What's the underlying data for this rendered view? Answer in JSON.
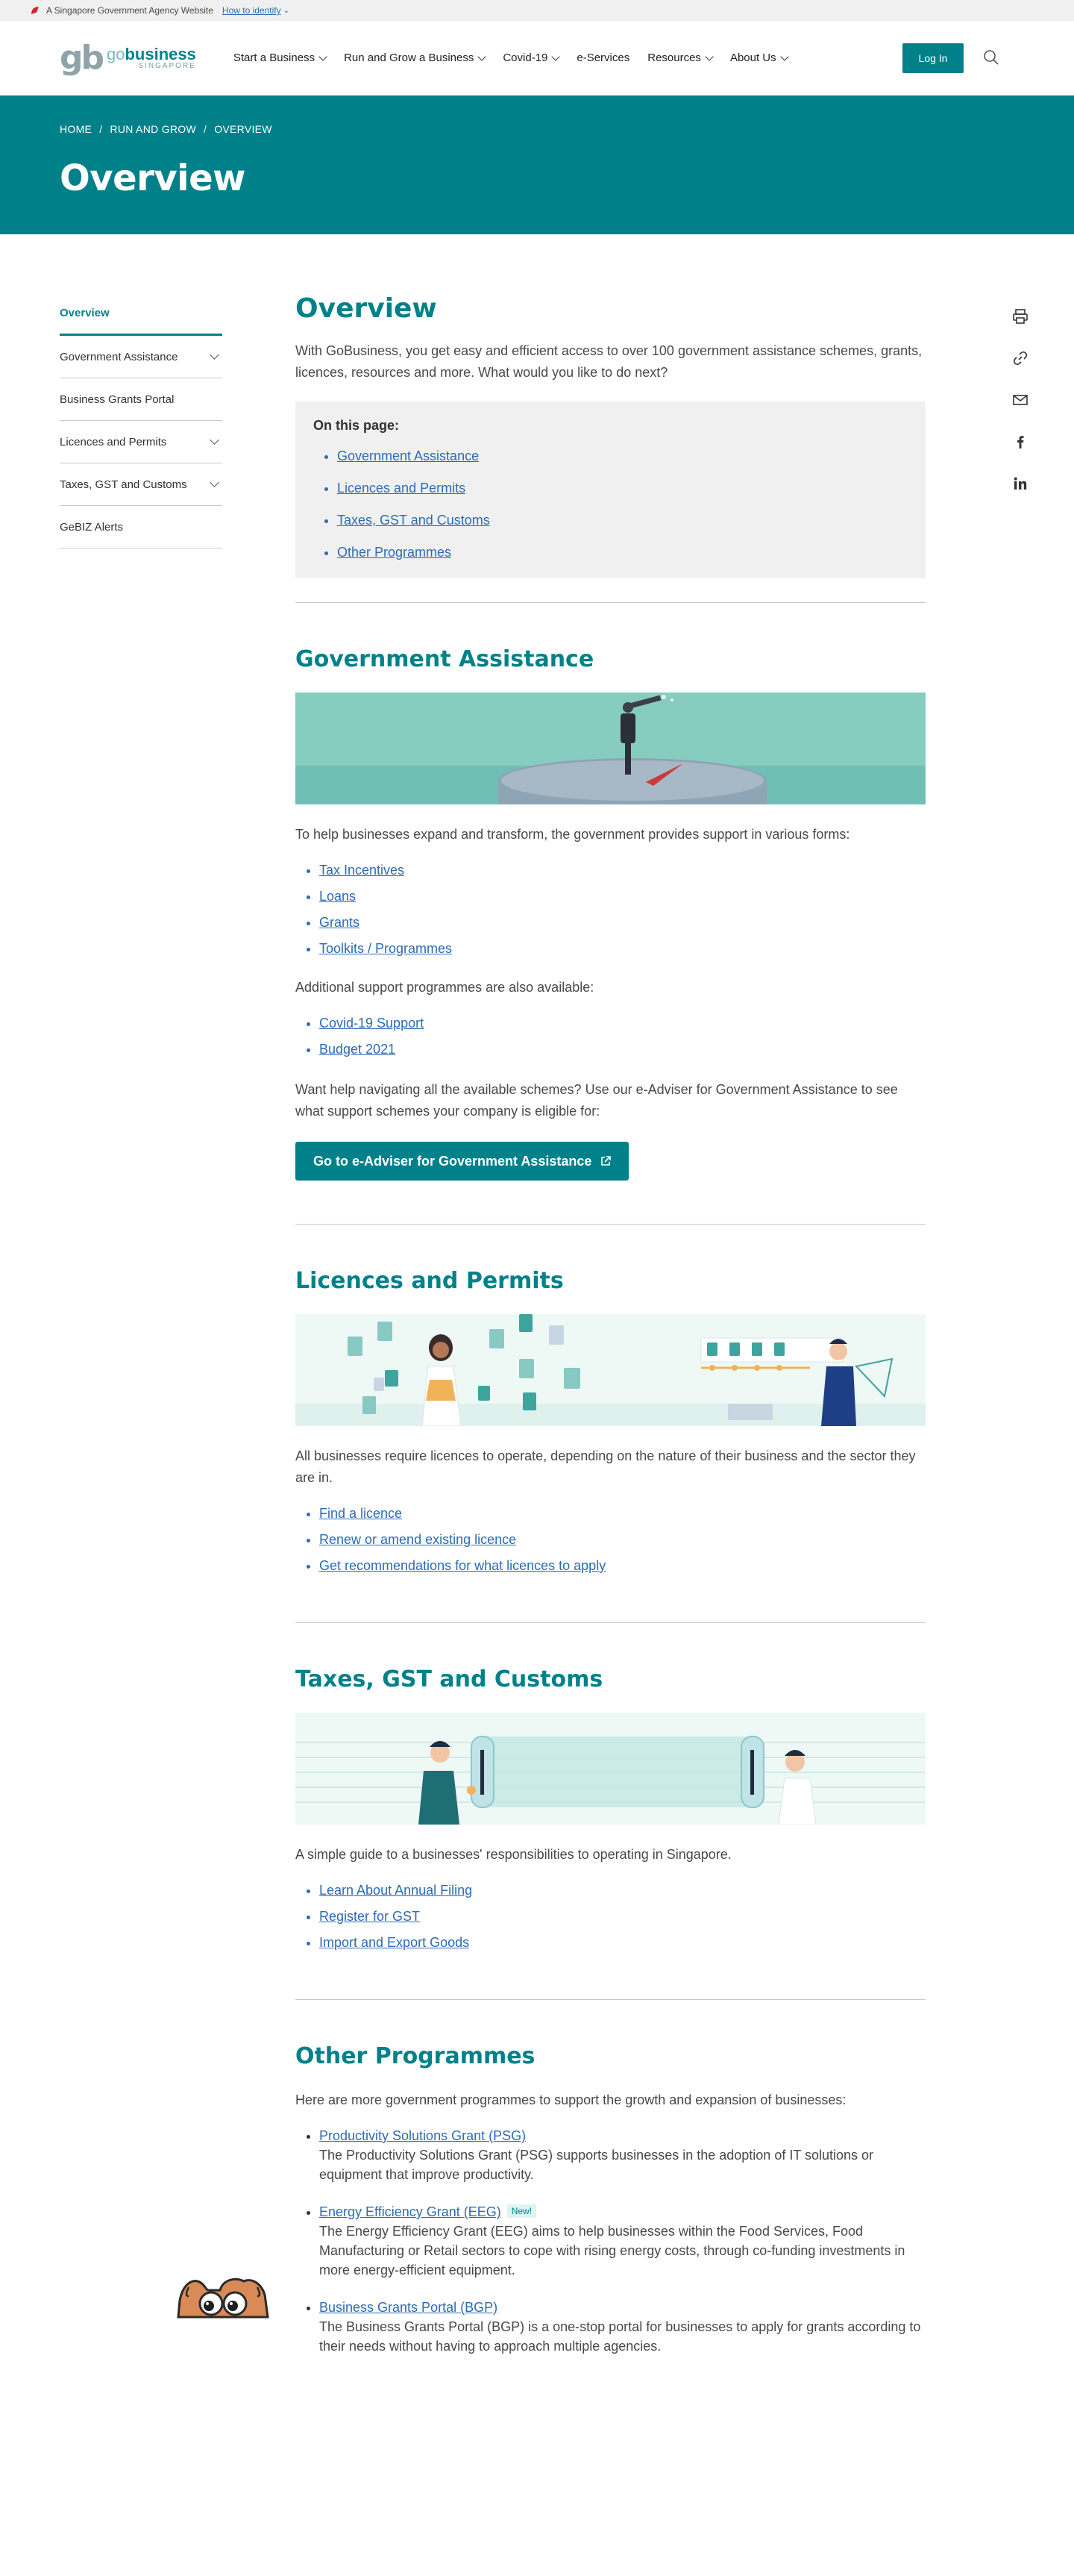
{
  "masthead": {
    "text": "A Singapore Government Agency Website",
    "identify": "How to identify"
  },
  "logo": {
    "mark": "gb",
    "word_go": "go",
    "word_business": "business",
    "tagline": "SINGAPORE"
  },
  "nav": [
    {
      "label": "Start a Business",
      "dropdown": true
    },
    {
      "label": "Run and Grow a Business",
      "dropdown": true
    },
    {
      "label": "Covid-19",
      "dropdown": true
    },
    {
      "label": "e-Services",
      "dropdown": false
    },
    {
      "label": "Resources",
      "dropdown": true
    },
    {
      "label": "About Us",
      "dropdown": true
    }
  ],
  "header": {
    "login": "Log In"
  },
  "breadcrumb": [
    "HOME",
    "RUN AND GROW",
    "OVERVIEW"
  ],
  "hero": {
    "title": "Overview"
  },
  "sidebar": [
    {
      "label": "Overview",
      "active": true,
      "dropdown": false
    },
    {
      "label": "Government Assistance",
      "active": false,
      "dropdown": true
    },
    {
      "label": "Business Grants Portal",
      "active": false,
      "dropdown": false
    },
    {
      "label": "Licences and Permits",
      "active": false,
      "dropdown": true
    },
    {
      "label": "Taxes, GST and Customs",
      "active": false,
      "dropdown": true
    },
    {
      "label": "GeBIZ Alerts",
      "active": false,
      "dropdown": false
    }
  ],
  "main": {
    "title": "Overview",
    "intro": "With GoBusiness, you get easy and efficient access to over 100 government assistance schemes, grants, licences, resources and more. What would you like to do next?",
    "toc": {
      "title": "On this page:",
      "items": [
        "Government Assistance",
        "Licences and Permits",
        "Taxes, GST and Customs",
        "Other Programmes"
      ]
    },
    "gov": {
      "title": "Government Assistance",
      "text": "To help businesses expand and transform, the government provides support in various forms:",
      "links": [
        "Tax Incentives",
        "Loans",
        "Grants",
        "Toolkits / Programmes"
      ],
      "additional": "Additional support programmes are also available:",
      "links2": [
        "Covid-19 Support",
        "Budget 2021"
      ],
      "help": "Want help navigating all the available schemes? Use our e-Adviser for Government Assistance to see what support schemes your company is eligible for:",
      "button": "Go to e-Adviser for Government Assistance"
    },
    "lic": {
      "title": "Licences and Permits",
      "text": "All businesses require licences to operate, depending on the nature of their business and the sector they are in.",
      "links": [
        "Find a licence",
        "Renew or amend existing licence",
        "Get recommendations for what licences to apply"
      ]
    },
    "tax": {
      "title": "Taxes, GST and Customs",
      "text": "A simple guide to a businesses' responsibilities to operating in Singapore.",
      "links": [
        "Learn About Annual Filing",
        "Register for GST",
        "Import and Export Goods"
      ]
    },
    "other": {
      "title": "Other Programmes",
      "text": "Here are more government programmes to support the growth and expansion of businesses:",
      "items": [
        {
          "link": "Productivity Solutions Grant (PSG)",
          "badge": "",
          "desc": "The Productivity Solutions Grant (PSG) supports businesses in the adoption of IT solutions or equipment that improve productivity."
        },
        {
          "link": "Energy Efficiency Grant (EEG)",
          "badge": "New!",
          "desc": "The Energy Efficiency Grant (EEG) aims to help businesses within the Food Services, Food Manufacturing or Retail sectors to cope with rising energy costs, through co-funding investments in more energy-efficient equipment."
        },
        {
          "link": "Business Grants Portal (BGP)",
          "badge": "",
          "desc": "The Business Grants Portal (BGP) is a one-stop portal for businesses to apply for grants according to their needs without having to approach multiple agencies."
        }
      ]
    }
  },
  "share_icons": [
    "print-icon",
    "link-icon",
    "email-icon",
    "facebook-icon",
    "linkedin-icon"
  ],
  "colors": {
    "brand": "#00818a",
    "link": "#2c6bb5"
  }
}
